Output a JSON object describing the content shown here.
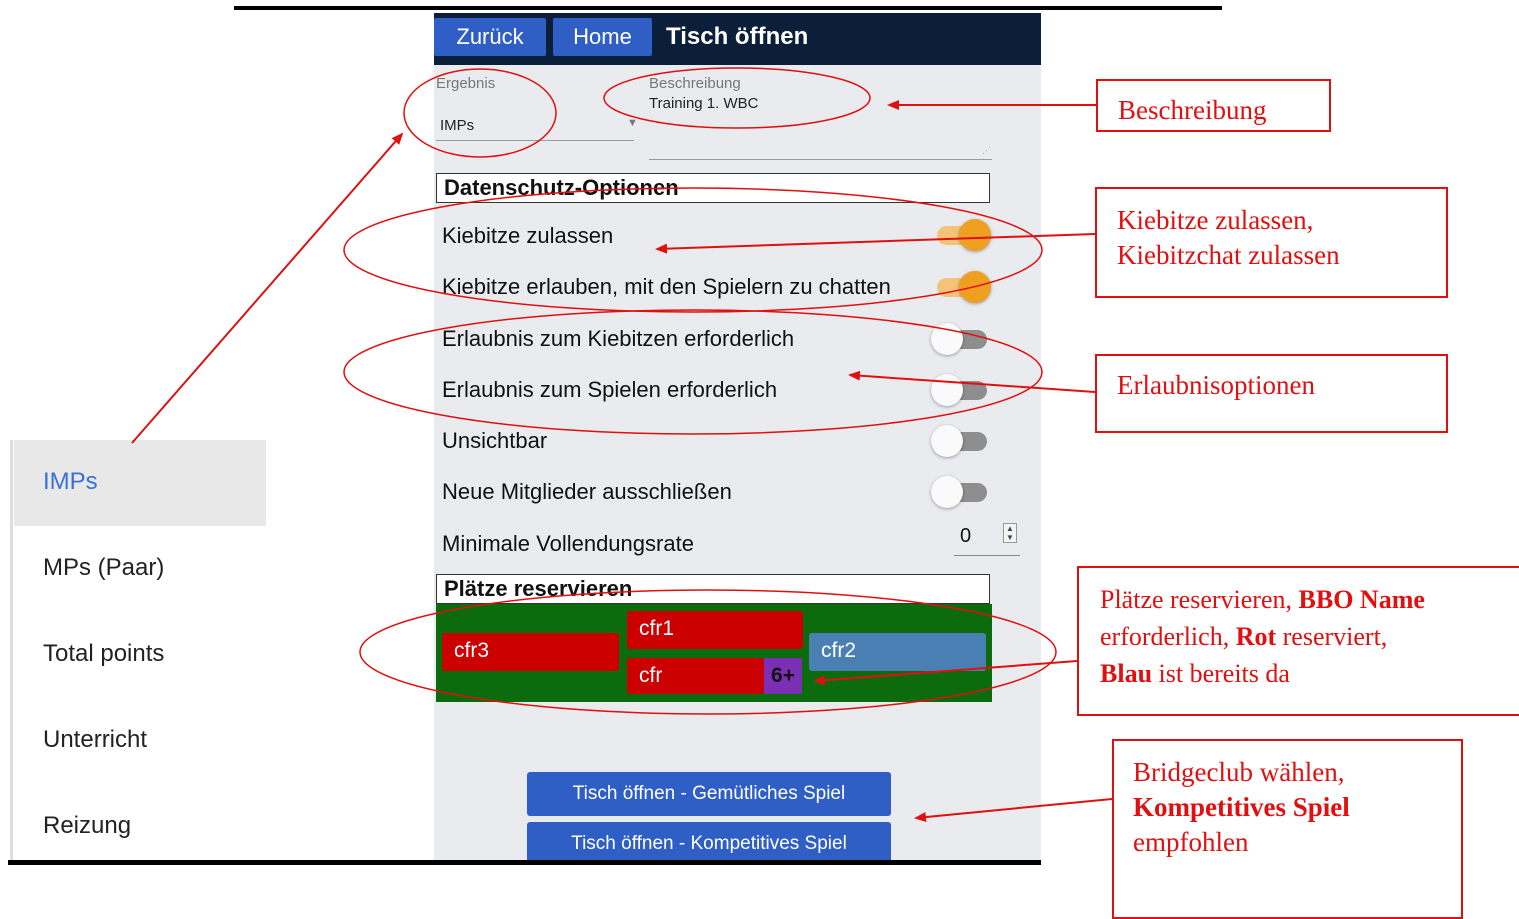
{
  "header": {
    "back_label": "Zurück",
    "home_label": "Home",
    "title": "Tisch öffnen"
  },
  "form": {
    "result_label": "Ergebnis",
    "result_value": "IMPs",
    "description_label": "Beschreibung",
    "description_value": "Training 1. WBC"
  },
  "privacy": {
    "title": "Datenschutz-Optionen",
    "options": [
      {
        "label": "Kiebitze zulassen",
        "on": true
      },
      {
        "label": "Kiebitze erlauben, mit den Spielern zu chatten",
        "on": true
      },
      {
        "label": "Erlaubnis zum Kiebitzen erforderlich",
        "on": false
      },
      {
        "label": "Erlaubnis zum Spielen erforderlich",
        "on": false
      },
      {
        "label": "Unsichtbar",
        "on": false
      },
      {
        "label": "Neue Mitglieder ausschließen",
        "on": false
      }
    ],
    "min_completion_label": "Minimale Vollendungsrate",
    "min_completion_value": "0"
  },
  "seats": {
    "title": "Plätze reservieren",
    "west": "cfr3",
    "north": "cfr1",
    "east": "cfr2",
    "south": "cfr",
    "south_badge": "6+",
    "colors": {
      "reserved": "#cc0000",
      "present": "#4a7fb4",
      "table": "#0c6b0c"
    }
  },
  "actions": {
    "open_casual": "Tisch öffnen - Gemütliches Spiel",
    "open_competitive": "Tisch öffnen - Kompetitives Spiel"
  },
  "dropdown": {
    "items": [
      "IMPs",
      "MPs (Paar)",
      "Total points",
      "Unterricht",
      "Reizung"
    ],
    "selected": "IMPs"
  },
  "callouts": {
    "description": "Beschreibung",
    "kibitz": [
      "Kiebitze zulassen,",
      "Kiebitzchat zulassen"
    ],
    "permission": "Erlaubnisoptionen",
    "seats": {
      "p1": "Plätze reservieren, ",
      "b1": "BBO Name",
      "p2": "erforderlich, ",
      "b2": "Rot",
      "p3": " reserviert,",
      "b3": "Blau",
      "p4": " ist bereits da"
    },
    "club": {
      "line1": "Bridgeclub wählen,",
      "bold": "Kompetitives Spiel",
      "line3": "empfohlen"
    }
  },
  "accent_color": "#e01010"
}
